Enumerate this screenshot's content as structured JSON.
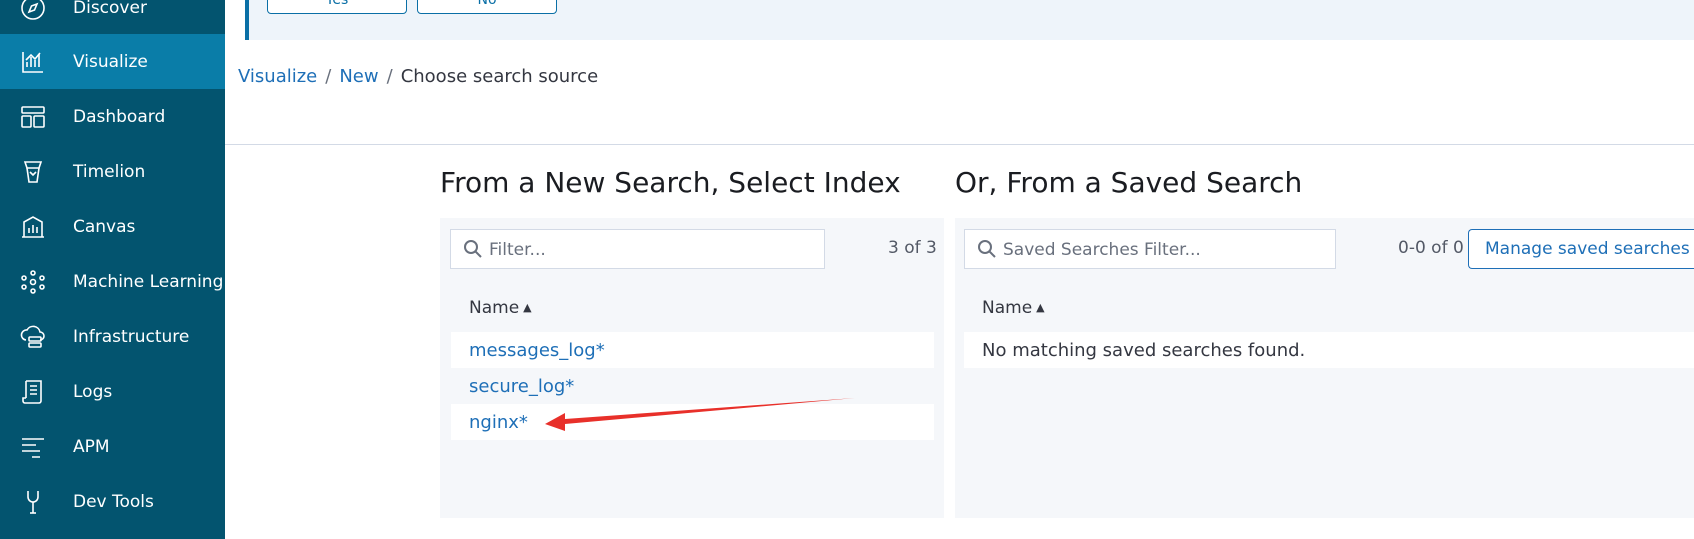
{
  "sidebar": {
    "items": [
      {
        "label": "Discover",
        "icon": "compass-icon",
        "active": false
      },
      {
        "label": "Visualize",
        "icon": "visualize-icon",
        "active": true
      },
      {
        "label": "Dashboard",
        "icon": "dashboard-icon",
        "active": false
      },
      {
        "label": "Timelion",
        "icon": "timelion-icon",
        "active": false
      },
      {
        "label": "Canvas",
        "icon": "canvas-icon",
        "active": false
      },
      {
        "label": "Machine Learning",
        "icon": "machine-learning-icon",
        "active": false
      },
      {
        "label": "Infrastructure",
        "icon": "infrastructure-icon",
        "active": false
      },
      {
        "label": "Logs",
        "icon": "logs-icon",
        "active": false
      },
      {
        "label": "APM",
        "icon": "apm-icon",
        "active": false
      },
      {
        "label": "Dev Tools",
        "icon": "dev-tools-icon",
        "active": false
      }
    ]
  },
  "callout": {
    "yes_label": "Yes",
    "no_label": "No"
  },
  "breadcrumbs": {
    "items": [
      "Visualize",
      "New"
    ],
    "current": "Choose search source",
    "separator": "/"
  },
  "index_panel": {
    "title": "From a New Search, Select Index",
    "filter_placeholder": "Filter...",
    "count": "3 of 3",
    "column_header": "Name",
    "rows": [
      "messages_log*",
      "secure_log*",
      "nginx*"
    ]
  },
  "saved_panel": {
    "title": "Or, From a Saved Search",
    "filter_placeholder": "Saved Searches Filter...",
    "count": "0-0 of 0",
    "manage_button": "Manage saved searches",
    "column_header": "Name",
    "empty_message": "No matching saved searches found."
  },
  "annotation": {
    "arrow_color": "#e8302a"
  }
}
